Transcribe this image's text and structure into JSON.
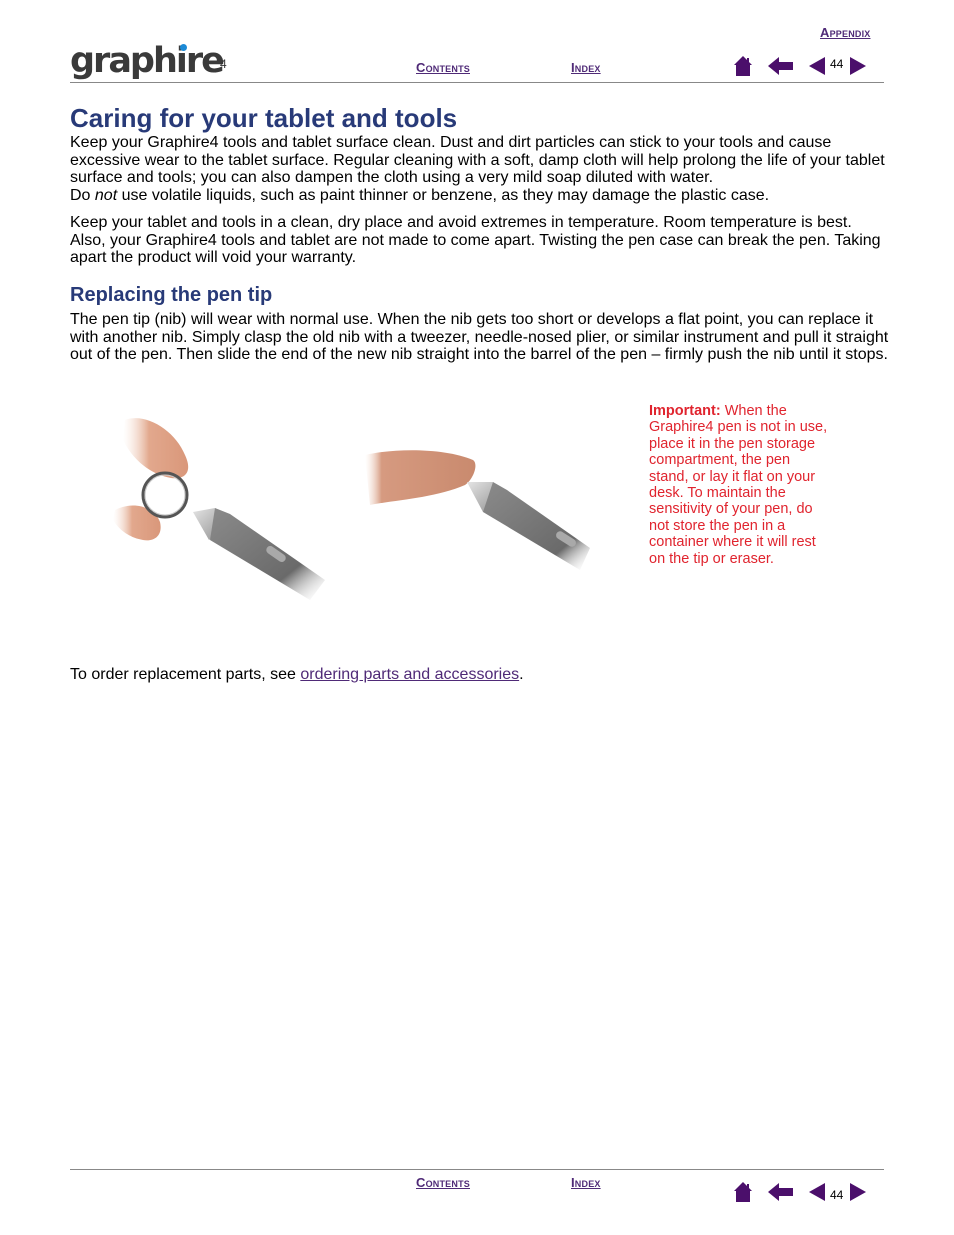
{
  "header": {
    "logo_text": "graphire",
    "logo_suffix": "4",
    "appendix_link": "Appendix",
    "contents_link": "Contents",
    "index_link": "Index",
    "page_number": "44",
    "icons": [
      "home-icon",
      "back-icon",
      "previous-page-icon",
      "next-page-icon"
    ]
  },
  "main": {
    "title": "Caring for your tablet and tools",
    "para1_a": "Keep your Graphire4 tools and tablet surface clean.  Dust and dirt particles can stick to your tools and cause excessive wear to the tablet surface.  Regular cleaning with a soft, damp cloth will help prolong the life of your tablet surface and tools; you can also dampen the cloth using a very mild soap diluted with water.",
    "para1_do": "Do ",
    "para1_not": "not",
    "para1_b": " use volatile liquids, such as paint thinner or benzene, as they may damage the plastic case.",
    "para2": "Keep your tablet and tools in a clean, dry place and avoid extremes in temperature.  Room temperature is best.  Also, your Graphire4 tools and tablet are not made to come apart.  Twisting the pen case can break the pen.  Taking apart the product will void your warranty.",
    "subtitle": "Replacing the pen tip",
    "para3": "The pen tip (nib) will wear with normal use.  When the nib gets too short or develops a flat point, you can replace it with another nib.  Simply clasp the old nib with a tweezer, needle-nosed plier, or similar instrument and pull it straight out of the pen.  Then slide the end of the new nib straight into the barrel of the pen – firmly push the nib until it stops.",
    "note_label": "Important:",
    "note_text": " When the Graphire4 pen is not in use, place it in the pen storage compartment, the pen stand, or lay it flat on your desk.  To maintain the sensitivity of your pen, do not store the pen in a container where it will rest on the tip or eraser.",
    "order_prefix": "To order replacement parts, see ",
    "order_link": "ordering parts and accessories",
    "order_suffix": "."
  },
  "footer": {
    "contents_link": "Contents",
    "index_link": "Index",
    "page_number": "44"
  },
  "colors": {
    "heading": "#283a78",
    "link": "#4f2a77",
    "note": "#e0242e",
    "nav_icon": "#4b0f6b"
  }
}
